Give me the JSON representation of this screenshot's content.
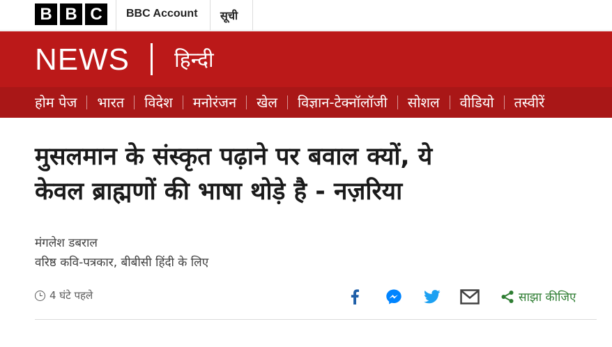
{
  "topbar": {
    "logo_letters": [
      "B",
      "B",
      "C"
    ],
    "account_label": "BBC Account",
    "menu_label": "सूची"
  },
  "masthead": {
    "brand": "NEWS",
    "language": "हिन्दी"
  },
  "nav": {
    "items": [
      "होम पेज",
      "भारत",
      "विदेश",
      "मनोरंजन",
      "खेल",
      "विज्ञान-टेक्नॉलॉजी",
      "सोशल",
      "वीडियो",
      "तस्वीरें"
    ]
  },
  "article": {
    "headline_line1": "मुसलमान के संस्कृत पढ़ाने पर बवाल क्यों, ये",
    "headline_line2": "केवल ब्राह्मणों की भाषा थोड़े है - नज़रिया",
    "author": "मंगलेश डबराल",
    "author_role": "वरिष्ठ कवि-पत्रकार, बीबीसी हिंदी के लिए",
    "timestamp": "4 घंटे पहले"
  },
  "share": {
    "label": "साझा कीजिए",
    "icons": [
      "facebook-icon",
      "messenger-icon",
      "twitter-icon",
      "email-icon",
      "share-icon"
    ]
  },
  "colors": {
    "masthead_red": "#bb1919",
    "nav_red": "#a91717",
    "share_green": "#2e7d32",
    "social_blue": "#1f5fa8",
    "messenger_blue": "#0084ff",
    "twitter_blue": "#1da1f2"
  }
}
